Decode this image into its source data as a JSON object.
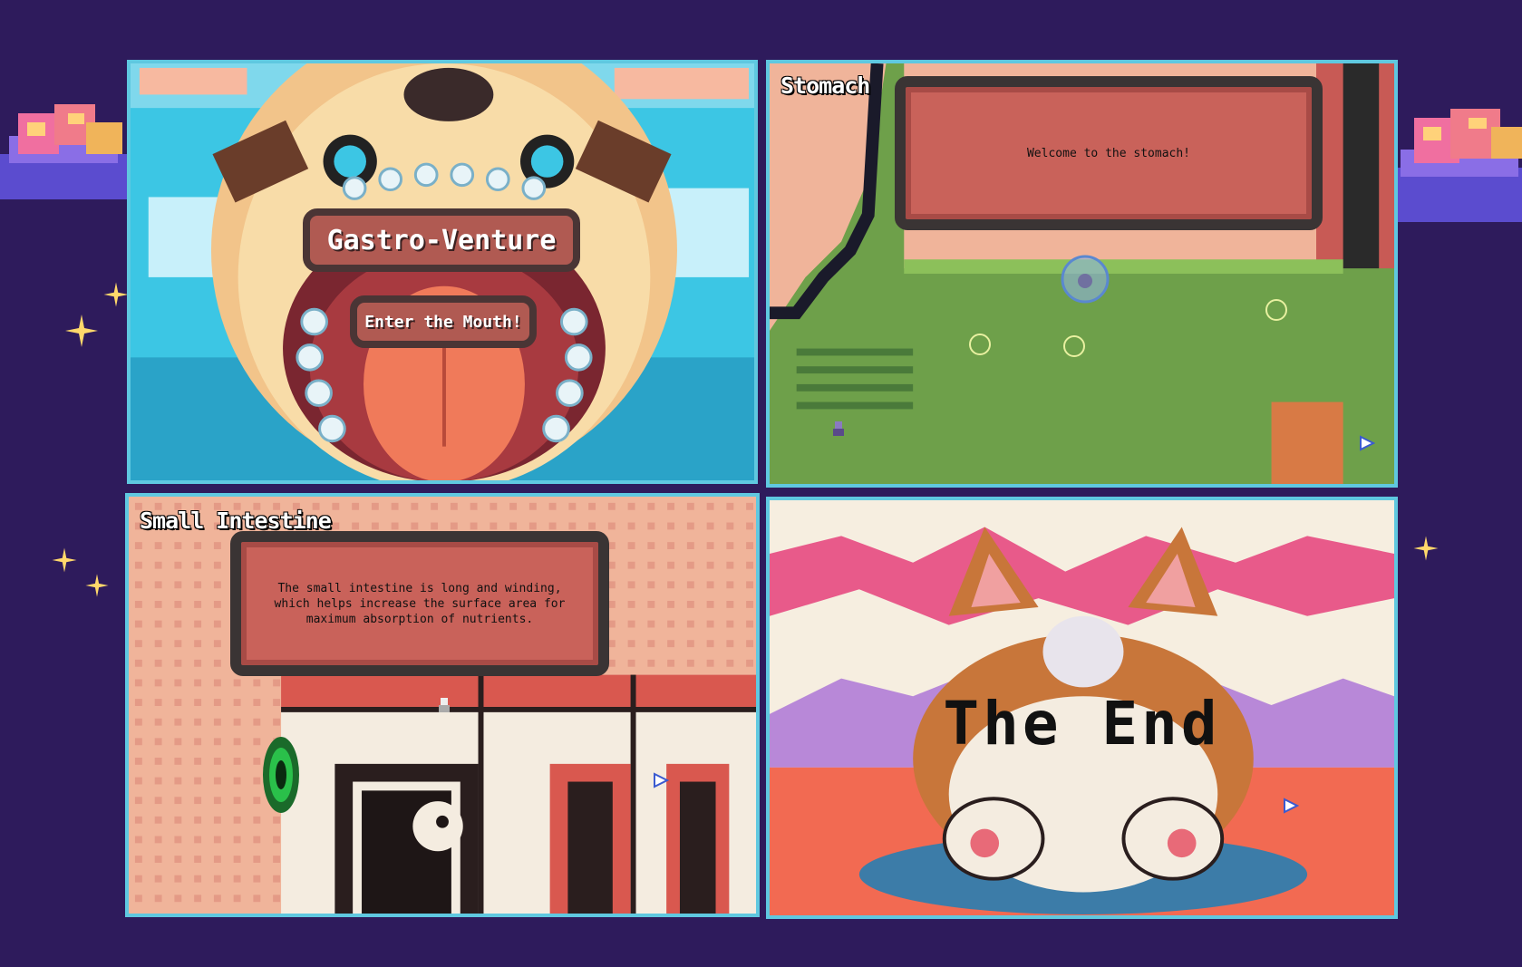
{
  "scenes": {
    "title": {
      "game_title": "Gastro-Venture",
      "start_button": "Enter the Mouth!"
    },
    "stomach": {
      "label": "Stomach",
      "dialog": "Welcome to the stomach!"
    },
    "small_intestine": {
      "label": "Small Intestine",
      "dialog": "The small intestine is long and winding, which helps increase the surface area for maximum absorption of nutrients."
    },
    "ending": {
      "title": "The End"
    }
  },
  "colors": {
    "background": "#2e1b5c",
    "panel_border": "#5fc8e0",
    "dialog_fill": "#c9625a",
    "dialog_border": "#3a3434",
    "grass": "#6ea04a",
    "sky": "#3cc6e4"
  },
  "icons": [
    "sparkle-icon",
    "pixel-cloud-icon",
    "cursor-arrow-icon",
    "portal-icon",
    "bubble-icon",
    "player-sprite-icon"
  ]
}
